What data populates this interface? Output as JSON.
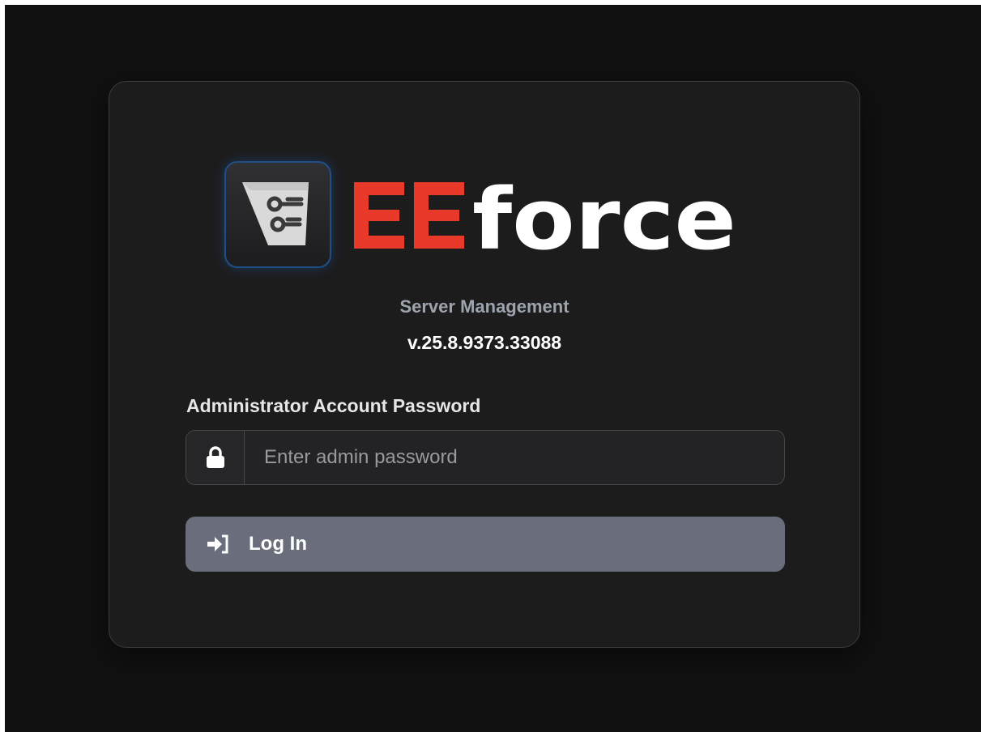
{
  "brand": {
    "name_part1": "EE",
    "name_part2": "force",
    "accent_color": "#e8392a",
    "text_color": "#ffffff",
    "logo_icon": "circuit-page-icon"
  },
  "header": {
    "subtitle": "Server Management",
    "version": "v.25.8.9373.33088"
  },
  "form": {
    "password_label": "Administrator Account Password",
    "password_placeholder": "Enter admin password",
    "password_value": "",
    "lock_icon": "lock-icon",
    "login_icon": "sign-in-icon",
    "login_label": "Log In",
    "button_color": "#6a6e7c"
  }
}
